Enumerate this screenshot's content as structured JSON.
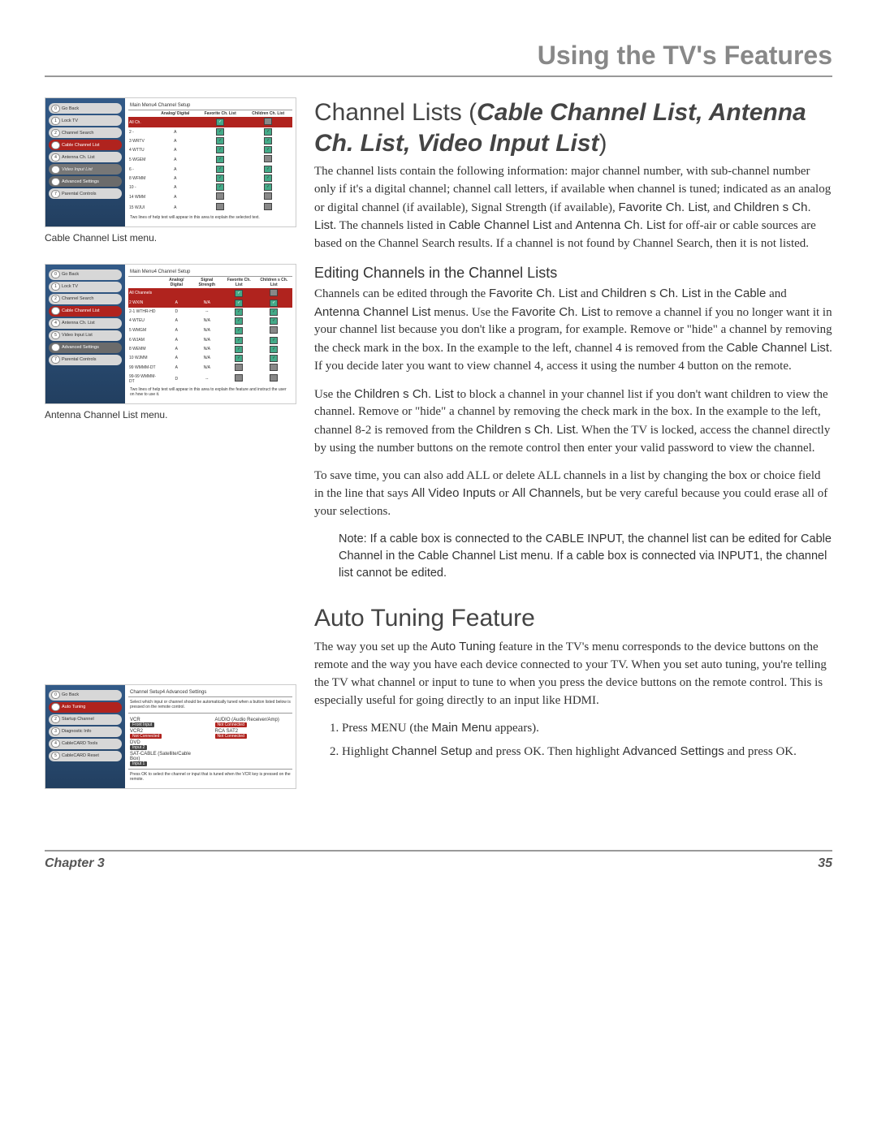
{
  "header": {
    "title": "Using the TV's Features"
  },
  "footer": {
    "chapter": "Chapter 3",
    "page": "35"
  },
  "section1": {
    "title_prefix": "Channel Lists (",
    "title_em": "Cable Channel List, Antenna Ch. List, Video Input List",
    "title_suffix": ")",
    "p1a": "The channel lists contain the following information: major channel number, with sub-channel number only if it's a digital channel; channel call letters, if available when channel is tuned; indicated as an analog or digital channel (if available), Signal Strength (if available), ",
    "p1b": "Favorite Ch. List",
    "p1c": ", and ",
    "p1d": "Children s Ch. List",
    "p1e": ". The channels listed in ",
    "p1f": "Cable Channel List",
    "p1g": " and ",
    "p1h": "Antenna Ch. List",
    "p1i": " for off-air or cable sources are based on the Channel Search results. If a channel is not found by Channel Search, then it is not listed."
  },
  "subsection1": {
    "title": "Editing Channels in the  Channel Lists",
    "p1a": "Channels can be edited through the ",
    "p1b": "Favorite Ch. List",
    "p1c": " and ",
    "p1d": "Children s Ch. List",
    "p1e": " in the ",
    "p1f": "Cable",
    "p1g": " and ",
    "p1h": "Antenna Channel List",
    "p1i": " menus. Use the ",
    "p1j": "Favorite Ch. List",
    "p1k": " to remove a channel if you no longer want it in your channel list because you don't like a program, for example. Remove or \"hide\" a channel by removing the check mark in the box. In the example to the left, channel 4 is removed from the ",
    "p1l": "Cable Channel List",
    "p1m": ". If you decide later you want to view channel 4, access it using the number 4 button on the remote.",
    "p2a": "Use the ",
    "p2b": "Children s Ch. List",
    "p2c": " to block a channel in your channel list if you don't want children to view the channel. Remove or \"hide\" a channel by removing the check mark in the box. In the example to the left, channel 8-2 is removed from the ",
    "p2d": "Children s Ch. List",
    "p2e": ". When the TV is locked, access the channel directly by using the number buttons on the remote control then enter your valid password to view the channel.",
    "p3a": "To save time, you can also add ALL or delete ALL channels in a list by changing the box or choice field in the line that says ",
    "p3b": "All Video Inputs",
    "p3c": " or ",
    "p3d": "All Channels",
    "p3e": ", but be very careful because you could erase all of your selections.",
    "note": "Note: If a cable box is connected to the CABLE INPUT, the channel list can be edited for Cable Channel in the Cable Channel List menu. If a cable box is connected via INPUT1, the channel list cannot be edited."
  },
  "section2": {
    "title": "Auto Tuning  Feature",
    "p1a": "The way you set up the ",
    "p1b": "Auto Tuning",
    "p1c": " feature in the TV's menu corresponds to the device buttons on the remote and the way you have each device connected to your TV. When you set auto tuning, you're telling the TV what channel or input to tune to when you press the device buttons on the remote control. This is especially useful for going directly to an input like HDMI.",
    "step1a": "Press MENU (the ",
    "step1b": "Main Menu",
    "step1c": " appears).",
    "step2a": "Highlight ",
    "step2b": "Channel Setup",
    "step2c": " and press OK. Then highlight ",
    "step2d": "Advanced Settings",
    "step2e": " and press OK."
  },
  "fig1": {
    "caption": "Cable Channel List menu.",
    "crumbs": "Main Menu4  Channel Setup",
    "menu": [
      "Go Back",
      "Lock TV",
      "Channel Search",
      "Cable Channel List",
      "Antenna Ch. List",
      "Video Input List",
      "Advanced Settings",
      "Parental Controls"
    ],
    "nums": [
      "0",
      "1",
      "2",
      "3",
      "4",
      "5",
      "",
      "7"
    ],
    "cols": [
      "",
      "Analog/ Digital",
      "Favorite Ch. List",
      "Children Ch. List"
    ],
    "rows": [
      {
        "n": "All Ch.",
        "d": "",
        "f": "on",
        "c": ""
      },
      {
        "n": "2 -",
        "d": "A",
        "f": "on",
        "c": "on"
      },
      {
        "n": "3 WRTV",
        "d": "A",
        "f": "on",
        "c": "on"
      },
      {
        "n": "4 WTTU",
        "d": "A",
        "f": "on",
        "c": "on"
      },
      {
        "n": "5 WGEM",
        "d": "A",
        "f": "on",
        "c": ""
      },
      {
        "n": "6 -",
        "d": "A",
        "f": "on",
        "c": "on"
      },
      {
        "n": "8 WFMM",
        "d": "A",
        "f": "on",
        "c": "on"
      },
      {
        "n": "10 -",
        "d": "A",
        "f": "on",
        "c": "on"
      },
      {
        "n": "14 WMM",
        "d": "A",
        "f": "",
        "c": ""
      },
      {
        "n": "15 WJUI",
        "d": "A",
        "f": "",
        "c": ""
      }
    ],
    "help": "Two lines of help text will appear in this area to explain the selected text."
  },
  "fig2": {
    "caption": "Antenna Channel List menu.",
    "crumbs": "Main Menu4  Channel Setup",
    "menu": [
      "Go Back",
      "Lock TV",
      "Channel Search",
      "Cable Channel List",
      "Antenna Ch. List",
      "Video Input List",
      "Advanced Settings",
      "Parental Controls"
    ],
    "nums": [
      "0",
      "1",
      "2",
      "3",
      "4",
      "5",
      "6",
      "7"
    ],
    "cols": [
      "",
      "Analog/ Digital",
      "Signal Strength",
      "Favorite Ch. List",
      "Children s Ch. List"
    ],
    "rows": [
      {
        "n": "All Channels",
        "d": "",
        "s": "",
        "f": "on",
        "c": ""
      },
      {
        "n": "2 WXIN",
        "d": "A",
        "s": "N/A",
        "f": "on",
        "c": "on",
        "sel": true
      },
      {
        "n": "2-1 WTHR-HD",
        "d": "D",
        "s": "--",
        "f": "on",
        "c": "on"
      },
      {
        "n": "4 WTEU",
        "d": "A",
        "s": "N/A",
        "f": "on",
        "c": "on"
      },
      {
        "n": "5 WMGM",
        "d": "A",
        "s": "N/A",
        "f": "on",
        "c": ""
      },
      {
        "n": "6 WJAM",
        "d": "A",
        "s": "N/A",
        "f": "on",
        "c": "on"
      },
      {
        "n": "8 WEMM",
        "d": "A",
        "s": "N/A",
        "f": "on",
        "c": "on"
      },
      {
        "n": "10 WJMM",
        "d": "A",
        "s": "N/A",
        "f": "on",
        "c": "on"
      },
      {
        "n": "99 WMMM-DT",
        "d": "A",
        "s": "N/A",
        "f": "",
        "c": ""
      },
      {
        "n": "99-99 WMMM-DT",
        "d": "D",
        "s": "--",
        "f": "",
        "c": ""
      }
    ],
    "help": "Two lines of help text will appear in this area to explain the feature and instruct the user on how to use it."
  },
  "fig3": {
    "crumbs": "Channel Setup4  Advanced Settings",
    "menu": [
      "Go Back",
      "Auto Tuning",
      "Startup Channel",
      "Diagnostic Info",
      "CableCARD Tools",
      "CableCARD Reset"
    ],
    "nums": [
      "0",
      "1",
      "2",
      "3",
      "4",
      "5"
    ],
    "intro": "Select which input or channel should be automatically tuned when a button listed below is pressed on the remote control.",
    "devices": [
      {
        "l": "VCR",
        "lv": "Front Input",
        "r": "AUDIO (Audio Receiver/Amp)",
        "rv": "Not Connected"
      },
      {
        "l": "VCR2",
        "lv": "Not Connected",
        "r": "RCA SAT2",
        "rv": "Not Connected"
      },
      {
        "l": "DVD",
        "lv": "Input 2",
        "r": "",
        "rv": ""
      },
      {
        "l": "SAT-CABLE (Satellite/Cable Box)",
        "lv": "Input 1",
        "r": "",
        "rv": ""
      }
    ],
    "help": "Press OK to select the channel or input that is tuned when the VCR key is pressed on the remote."
  }
}
